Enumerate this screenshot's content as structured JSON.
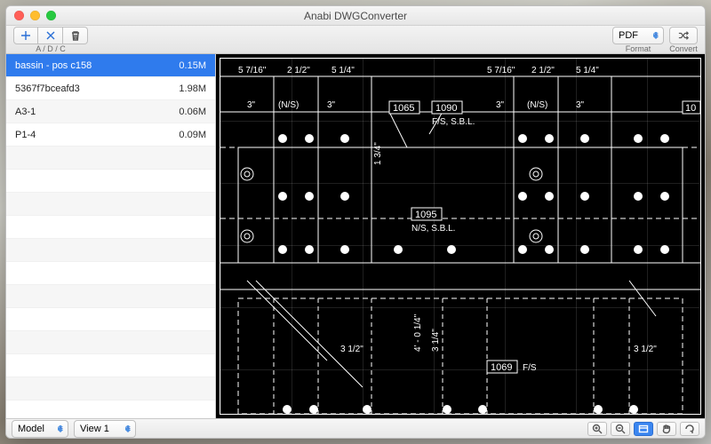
{
  "window": {
    "title": "Anabi DWGConverter"
  },
  "toolbar": {
    "add_label": "A",
    "delete_label": "D",
    "clear_label": "C",
    "adc_caption": "A / D / C",
    "format_select": "PDF",
    "format_caption": "Format",
    "convert_caption": "Convert"
  },
  "files": [
    {
      "name": "bassin - pos c158",
      "size": "0.15M",
      "selected": true
    },
    {
      "name": "5367f7bceafd3",
      "size": "1.98M",
      "selected": false
    },
    {
      "name": "A3-1",
      "size": "0.06M",
      "selected": false
    },
    {
      "name": "P1-4",
      "size": "0.09M",
      "selected": false
    }
  ],
  "bottombar": {
    "space_select": "Model",
    "view_select": "View 1"
  },
  "cad_labels": {
    "dim_5_7_16_a": "5 7/16\"",
    "dim_2_1_2_a": "2 1/2\"",
    "dim_5_1_4_a": "5 1/4\"",
    "dim_5_7_16_b": "5 7/16\"",
    "dim_2_1_2_b": "2 1/2\"",
    "dim_5_1_4_b": "5 1/4\"",
    "dim_3in_a": "3\"",
    "ns_a": "(N/S)",
    "dim_3in_b": "3\"",
    "tag_1065": "1065",
    "tag_1090": "1090",
    "fs_sbl": "F/S, S.B.L.",
    "dim_3in_c": "3\"",
    "ns_b": "(N/S)",
    "dim_3in_d": "3\"",
    "tag_1095": "1095",
    "ns_sbl": "N/S, S.B.L.",
    "dim_1_3_4": "1 3/4\"",
    "dim_3_1_2_a": "3 1/2\"",
    "dim_4_0_1_4": "4' - 0 1/4\"",
    "dim_3_1_4": "3 1/4\"",
    "tag_1069": "1069",
    "fs": "F/S",
    "dim_3_1_2_b": "3 1/2\"",
    "tag_10xx": "10"
  }
}
